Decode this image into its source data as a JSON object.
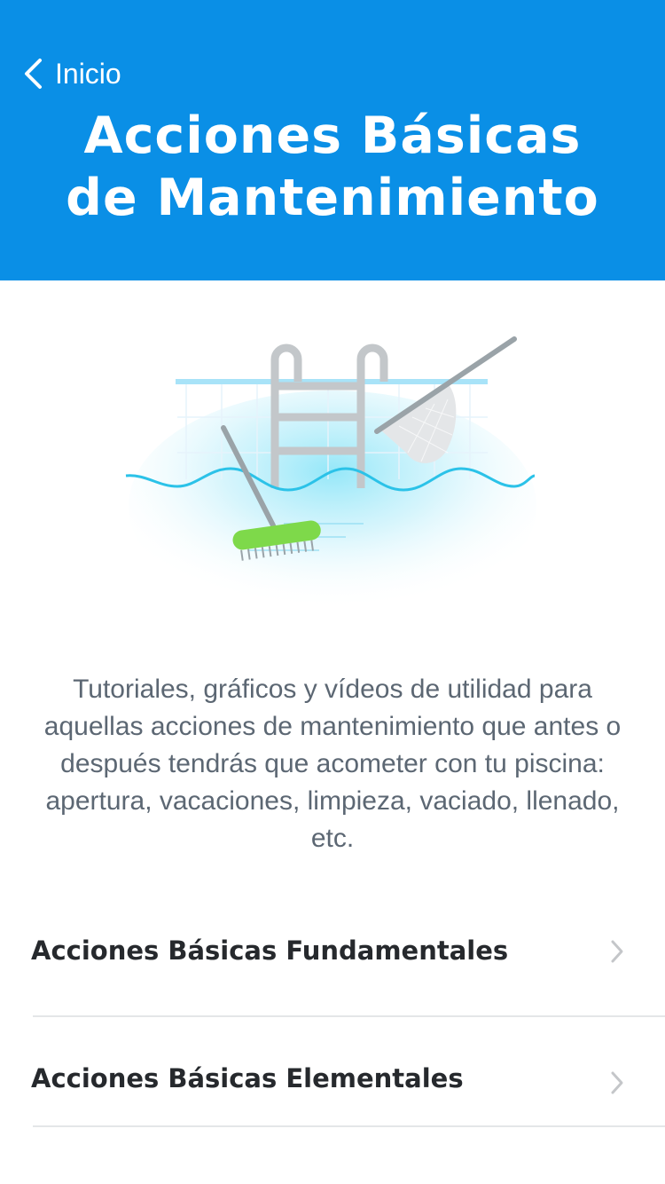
{
  "header": {
    "back_label": "Inicio",
    "title_line1": "Acciones Básicas",
    "title_line2": "de Mantenimiento",
    "background_color": "#0a8fe6"
  },
  "illustration": {
    "icon": "pool-maintenance-illustration"
  },
  "description": "Tutoriales, gráficos y vídeos de utilidad para aquellas acciones de mantenimiento que antes o después tendrás que acometer con tu piscina: apertura, vacaciones, limpieza, vaciado, llenado, etc.",
  "menu": {
    "items": [
      {
        "label": "Acciones Básicas Fundamentales",
        "icon": "chevron-right-icon"
      },
      {
        "label": "Acciones Básicas Elementales",
        "icon": "chevron-right-icon"
      }
    ]
  }
}
